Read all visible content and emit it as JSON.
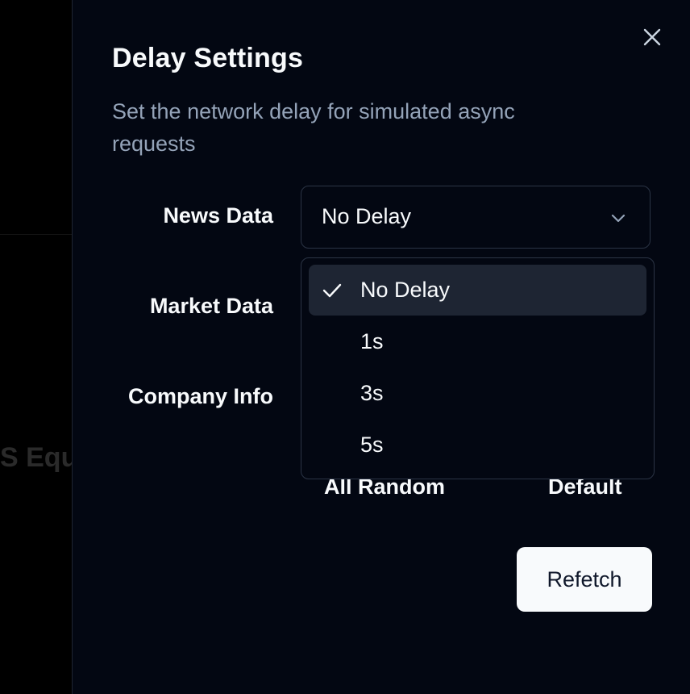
{
  "backdrop": {
    "partial_text": "S Equ"
  },
  "dialog": {
    "title": "Delay Settings",
    "description": "Set the network delay for simulated async requests",
    "close_icon": "x-icon"
  },
  "rows": [
    {
      "label": "News Data",
      "value": "No Delay"
    },
    {
      "label": "Market Data"
    },
    {
      "label": "Company Info"
    }
  ],
  "dropdown": {
    "options": [
      {
        "label": "No Delay",
        "selected": true
      },
      {
        "label": "1s",
        "selected": false
      },
      {
        "label": "3s",
        "selected": false
      },
      {
        "label": "5s",
        "selected": false
      }
    ],
    "check_icon": "check-icon"
  },
  "footer_labels": {
    "all_random": "All Random",
    "default": "Default"
  },
  "actions": {
    "refetch": "Refetch"
  },
  "colors": {
    "sheet_bg": "#030712",
    "text_primary": "#f8fafc",
    "text_muted": "#94a3b8",
    "border": "#2b3445",
    "option_selected_bg": "#1e2533",
    "button_bg": "#f8fafc",
    "button_text": "#0f172a"
  }
}
